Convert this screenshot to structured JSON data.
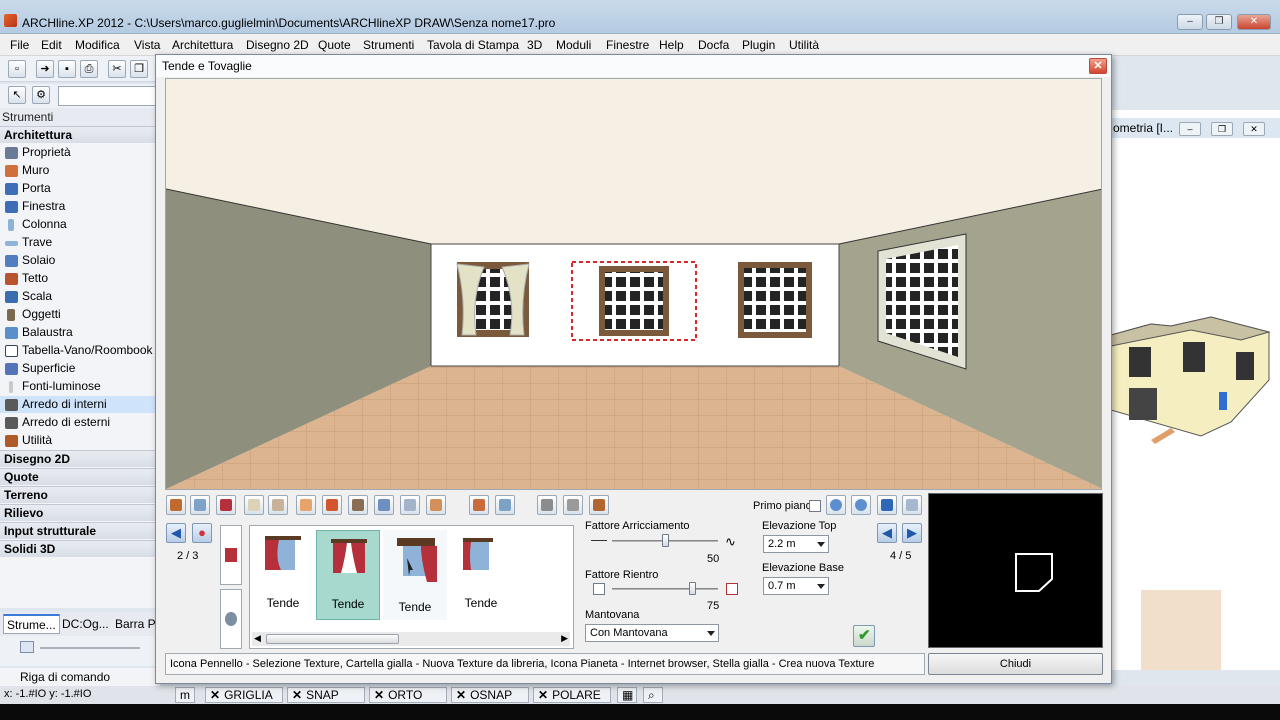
{
  "window": {
    "title": "ARCHline.XP 2012 - C:\\Users\\marco.guglielmin\\Documents\\ARCHlineXP DRAW\\Senza nome17.pro",
    "minimize": "–",
    "restore": "❐",
    "close": "✕"
  },
  "menu": [
    "File",
    "Edit",
    "Modifica",
    "Vista",
    "Architettura",
    "Disegno 2D",
    "Quote",
    "Strumenti",
    "Tavola di Stampa",
    "3D",
    "Moduli",
    "Finestre",
    "Help",
    "Docfa",
    "Plugin",
    "Utilità"
  ],
  "left_panel": {
    "header": "Strumenti",
    "section_architettura": "Architettura",
    "items": [
      "Proprietà",
      "Muro",
      "Porta",
      "Finestra",
      "Colonna",
      "Trave",
      "Solaio",
      "Tetto",
      "Scala",
      "Oggetti",
      "Balaustra",
      "Tabella-Vano/Roombook",
      "Superficie",
      "Fonti-luminose",
      "Arredo di interni",
      "Arredo di esterni",
      "Utilità"
    ],
    "selected_item": "Arredo di interni",
    "categories": [
      "Disegno 2D",
      "Quote",
      "Terreno",
      "Rilievo",
      "Input strutturale",
      "Solidi 3D"
    ],
    "tabs": [
      "Strume...",
      "DC:Og...",
      "Barra P..."
    ]
  },
  "command_line": "Riga di comando",
  "coords": "x: -1.#IO   y: -1.#IO",
  "status_bar": {
    "m": "m",
    "items": [
      "GRIGLIA",
      "SNAP",
      "ORTO",
      "OSNAP",
      "POLARE"
    ]
  },
  "right_window": {
    "title": "ometria [I..."
  },
  "dialog": {
    "title": "Tende e Tovaglie",
    "close": "✕",
    "primo_piano_label": "Primo piano",
    "page_left": "2 / 3",
    "page_right": "4 / 5",
    "gallery": [
      {
        "label": "Tende",
        "selected": false
      },
      {
        "label": "Tende",
        "selected": true
      },
      {
        "label": "Tende",
        "selected": false
      },
      {
        "label": "Tende",
        "selected": false
      }
    ],
    "fattore_arricciamento": {
      "label": "Fattore Arricciamento",
      "value": "50",
      "level": 0.5
    },
    "fattore_rientro": {
      "label": "Fattore Rientro",
      "value": "75",
      "level": 0.75
    },
    "mantovana": {
      "label": "Mantovana",
      "value": "Con Mantovana"
    },
    "elevazione_top": {
      "label": "Elevazione Top",
      "value": "2.2 m"
    },
    "elevazione_base": {
      "label": "Elevazione Base",
      "value": "0.7 m"
    },
    "hint": "Icona Pennello - Selezione Texture,  Cartella gialla - Nuova Texture da libreria, Icona Pianeta - Internet browser, Stella gialla - Crea nuova Texture",
    "close_button": "Chiudi"
  }
}
